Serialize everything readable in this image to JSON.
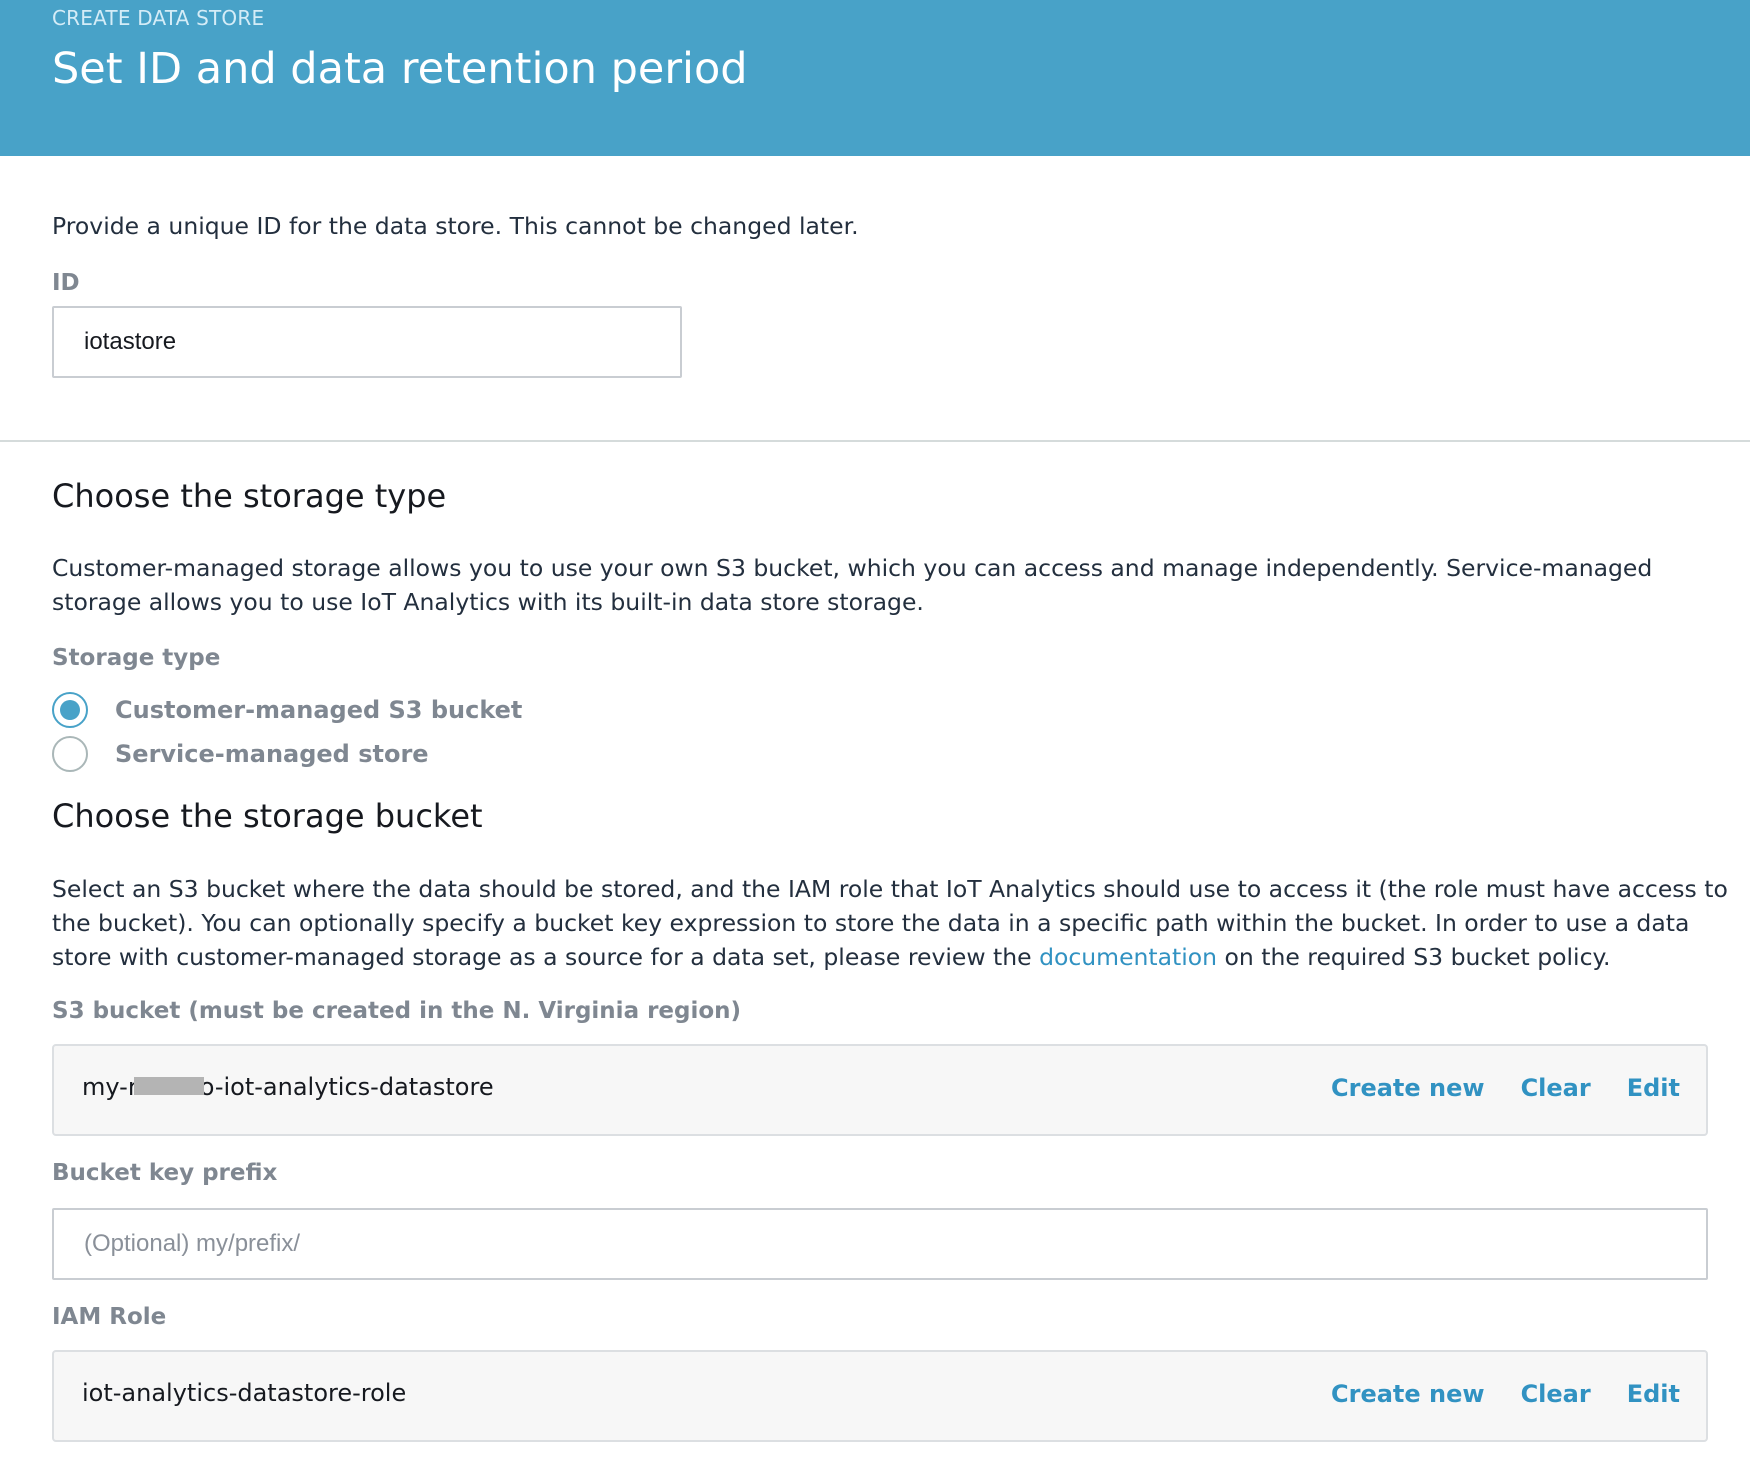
{
  "header": {
    "eyebrow": "CREATE DATA STORE",
    "title": "Set ID and data retention period"
  },
  "id_section": {
    "description": "Provide a unique ID for the data store. This cannot be changed later.",
    "label": "ID",
    "value": "iotastore"
  },
  "storage_type": {
    "heading": "Choose the storage type",
    "description": "Customer-managed storage allows you to use your own S3 bucket, which you can access and manage independently. Service-managed storage allows you to use IoT Analytics with its built-in data store storage.",
    "label": "Storage type",
    "options": [
      {
        "label": "Customer-managed S3 bucket",
        "selected": true
      },
      {
        "label": "Service-managed store",
        "selected": false
      }
    ]
  },
  "storage_bucket": {
    "heading": "Choose the storage bucket",
    "description_before_link": "Select an S3 bucket where the data should be stored, and the IAM role that IoT Analytics should use to access it (the role must have access to the bucket). You can optionally specify a bucket key expression to store the data in a specific path within the bucket. In order to use a data store with customer-managed storage as a source for a data set, please review the ",
    "link_text": "documentation",
    "description_after_link": " on the required S3 bucket policy.",
    "s3_label": "S3 bucket (must be created in the N. Virginia region)",
    "s3_value_prefix": "my-r",
    "s3_value_suffix": "o-iot-analytics-datastore",
    "prefix_label": "Bucket key prefix",
    "prefix_placeholder": "(Optional) my/prefix/",
    "iam_label": "IAM Role",
    "iam_value": "iot-analytics-datastore-role",
    "actions": {
      "create_new": "Create new",
      "clear": "Clear",
      "edit": "Edit"
    }
  },
  "colors": {
    "header_bg": "#48a2c8",
    "accent": "#3192c2",
    "label_gray": "#7f8791"
  }
}
